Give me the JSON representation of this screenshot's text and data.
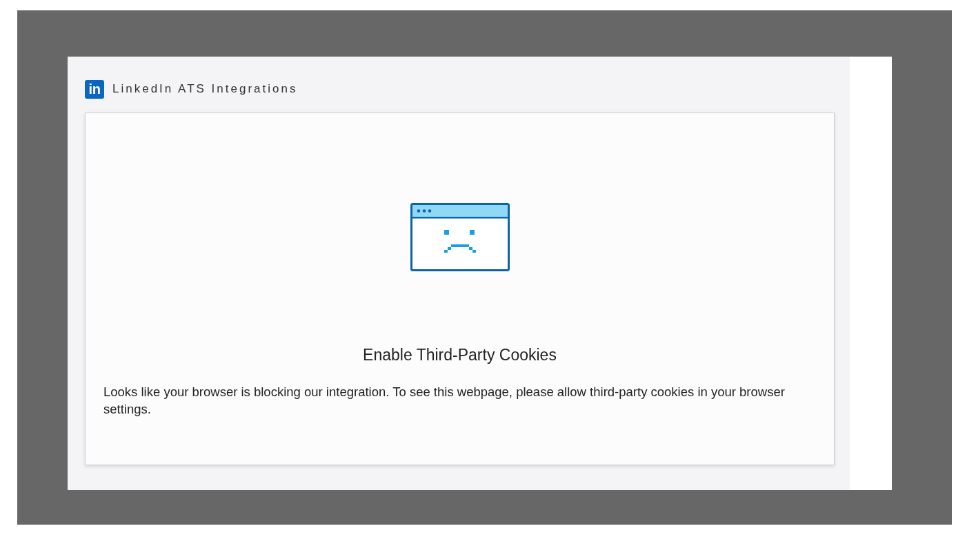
{
  "header": {
    "logo": "in",
    "title": "LinkedIn ATS Integrations"
  },
  "message": {
    "title": "Enable Third-Party Cookies",
    "body": "Looks like your browser is blocking our integration. To see this webpage, please allow third-party cookies in your browser settings."
  }
}
